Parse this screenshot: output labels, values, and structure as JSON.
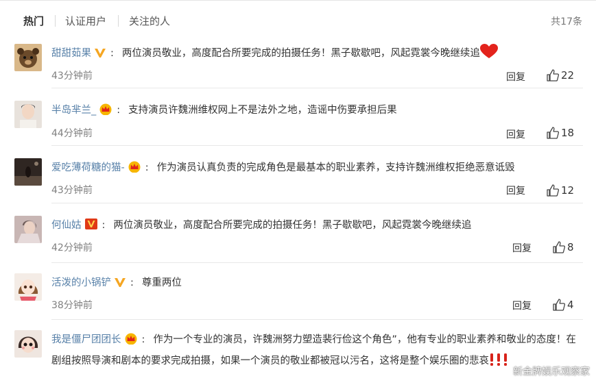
{
  "tabs": [
    {
      "label": "热门",
      "active": true
    },
    {
      "label": "认证用户",
      "active": false
    },
    {
      "label": "关注的人",
      "active": false
    }
  ],
  "total_label": "共17条",
  "comments": [
    {
      "user": "甜甜茹果",
      "badge": "v-gold-icon",
      "text": "两位演员敬业，高度配合所要完成的拍摄任务！黑子歇歇吧，风起霓裳今晚继续追",
      "emoji": "red-heart-icon",
      "time": "43分钟前",
      "reply": "回复",
      "likes": "22"
    },
    {
      "user": "半岛芈兰_",
      "badge": "crown-icon",
      "text": "支持演员许魏洲维权网上不是法外之地，造谣中伤要承担后果",
      "time": "44分钟前",
      "reply": "回复",
      "likes": "18"
    },
    {
      "user": "爱吃薄荷糖的猫-",
      "badge": "crown-icon",
      "text": "作为演员认真负责的完成角色是最基本的职业素养，支持许魏洲维权拒绝恶意诋毁",
      "time": "43分钟前",
      "reply": "回复",
      "likes": "12"
    },
    {
      "user": "何仙姑",
      "badge": "v-red-icon",
      "text": "两位演员敬业，高度配合所要完成的拍摄任务！黑子歇歇吧，风起霓裳今晚继续追",
      "time": "42分钟前",
      "reply": "回复",
      "likes": "8"
    },
    {
      "user": "活泼的小锅铲",
      "badge": "v-gold-icon",
      "text": "尊重两位",
      "time": "38分钟前",
      "reply": "回复",
      "likes": "4"
    },
    {
      "user": "我是僵尸团团长",
      "badge": "crown-icon",
      "text": "作为一个专业的演员，许魏洲努力塑造裴行俭这个角色”，他有专业的职业素养和敬业的态度！在剧组按照导演和剧本的要求完成拍摄，如果一个演员的敬业都被冠以污名，这将是整个娱乐圈的悲哀",
      "emoji": "exclamation-icons"
    }
  ],
  "watermark": "新金牌娱乐观察家",
  "colors": {
    "username": "#5780a8",
    "vip_gold": "#f5a623",
    "vip_red": "#e03a17",
    "divider": "#e8e8e8"
  }
}
